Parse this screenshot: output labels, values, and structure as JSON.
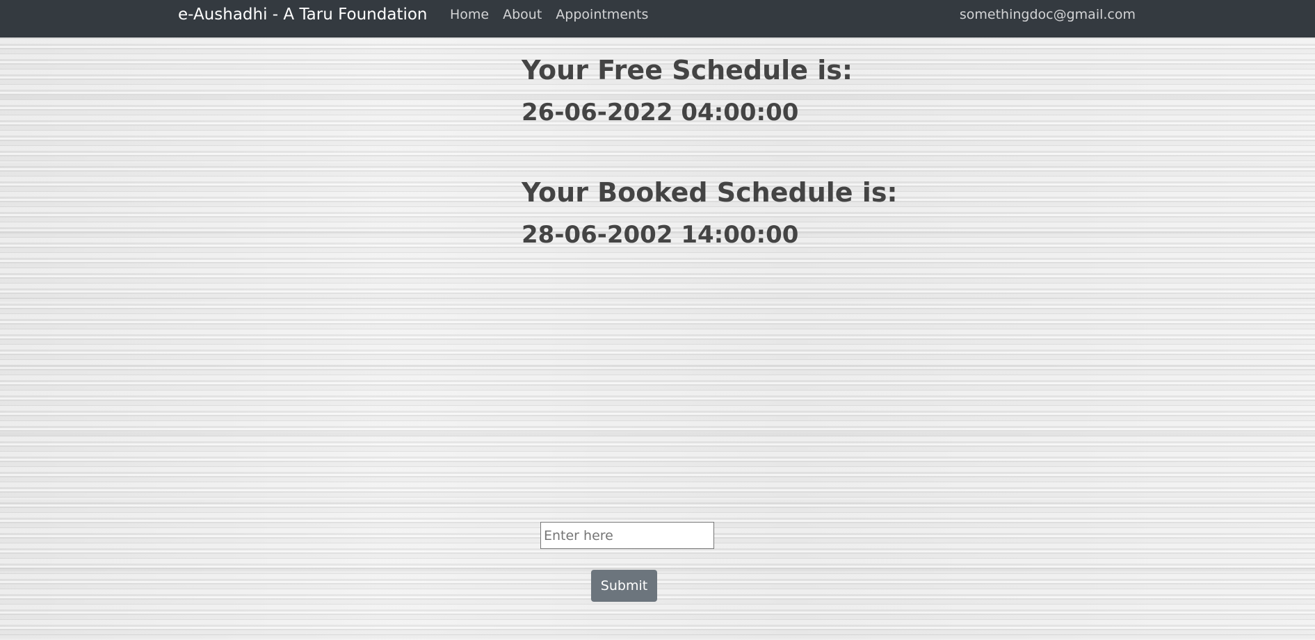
{
  "navbar": {
    "brand": "e-Aushadhi - A Taru Foundation",
    "links": [
      "Home",
      "About",
      "Appointments"
    ],
    "user_email": "somethingdoc@gmail.com",
    "background_color": "#343a40"
  },
  "schedule": {
    "free_heading": "Your Free Schedule is:",
    "free_value": "26-06-2022 04:00:00",
    "booked_heading": "Your Booked Schedule is:",
    "booked_value": "28-06-2002 14:00:00"
  },
  "form": {
    "input_placeholder": "Enter here",
    "input_value": "",
    "submit_label": "Submit",
    "submit_color": "#6c757d"
  }
}
